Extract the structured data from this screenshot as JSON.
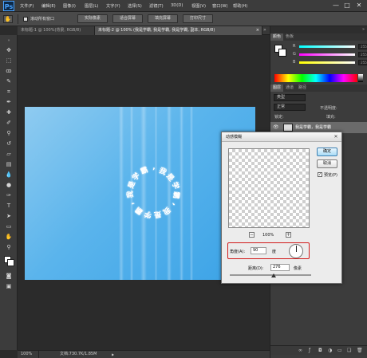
{
  "app": {
    "logo": "Ps"
  },
  "menu": [
    "文件(F)",
    "编辑(E)",
    "图像(I)",
    "图层(L)",
    "文字(Y)",
    "选择(S)",
    "滤镜(T)",
    "3D(D)",
    "视图(V)",
    "窗口(W)",
    "帮助(H)"
  ],
  "window_controls": {
    "minimize": "—",
    "maximize": "□",
    "close": "✕"
  },
  "options_bar": {
    "checkbox_label": "滚动所有窗口",
    "buttons": [
      "实际像素",
      "适合屏幕",
      "填充屏幕",
      "打印尺寸"
    ]
  },
  "tabs": [
    {
      "label": "未标题-1 @ 100%(背景, RGB/8)",
      "close": "×"
    },
    {
      "label": "未标题-2 @ 100% (我是学霸, 我是学霸, 我是学霸, 副本, RGB/8)",
      "close": "×"
    }
  ],
  "tab_scroll": "»",
  "canvas": {
    "text_segments": [
      "我",
      "是",
      "学",
      "霸",
      ",",
      "我",
      "是",
      "学",
      "霸",
      ",",
      "我",
      "是",
      "学",
      "霸",
      ","
    ]
  },
  "status": {
    "zoom": "100%",
    "doc_info": "文档:730.7K/1.85M",
    "arrow": "▶"
  },
  "right_panel": {
    "color_tabs": [
      "颜色",
      "色板"
    ],
    "slider_labels": [
      "R",
      "G",
      "B"
    ],
    "slider_values": [
      "255",
      "255",
      "255"
    ],
    "layer_tabs": [
      "图层",
      "通道",
      "路径"
    ],
    "layer_kind": "类型",
    "blend_mode": "正常",
    "opacity_label": "不透明度:",
    "fill_label": "填充:",
    "lock_label": "锁定:",
    "layer_name": "我是学霸，我是学霸"
  },
  "dialog": {
    "title": "动感模糊",
    "close": "✕",
    "ok": "确定",
    "cancel": "取消",
    "preview_label": "预览(P)",
    "preview_checked": "✓",
    "zoom_value": "100%",
    "zoom_minus": "−",
    "zoom_plus": "+",
    "angle_label": "角度(A):",
    "angle_value": "90",
    "angle_unit": "度",
    "distance_label": "距离(D):",
    "distance_value": "276",
    "distance_unit": "像素"
  },
  "colors": {
    "accent": "#0d2a49",
    "highlight_box": "#d11a1a",
    "canvas_blue": "#4aaceb"
  }
}
